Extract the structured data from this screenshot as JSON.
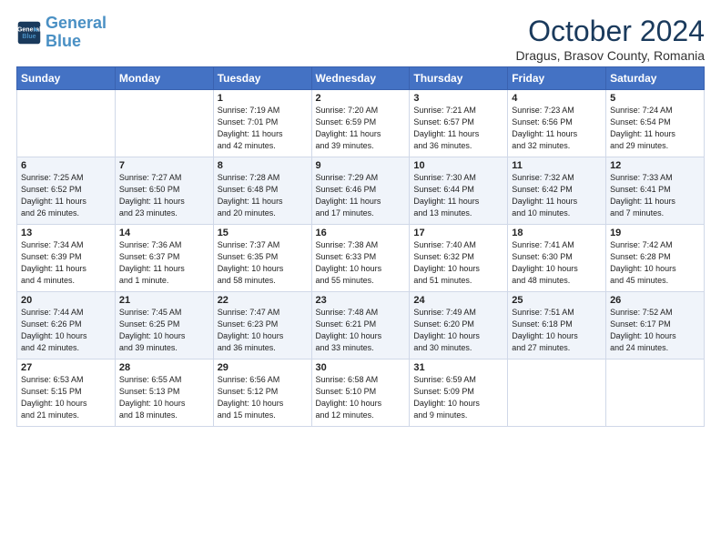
{
  "logo": {
    "line1": "General",
    "line2": "Blue"
  },
  "title": "October 2024",
  "subtitle": "Dragus, Brasov County, Romania",
  "weekdays": [
    "Sunday",
    "Monday",
    "Tuesday",
    "Wednesday",
    "Thursday",
    "Friday",
    "Saturday"
  ],
  "weeks": [
    [
      {
        "day": "",
        "info": ""
      },
      {
        "day": "",
        "info": ""
      },
      {
        "day": "1",
        "info": "Sunrise: 7:19 AM\nSunset: 7:01 PM\nDaylight: 11 hours\nand 42 minutes."
      },
      {
        "day": "2",
        "info": "Sunrise: 7:20 AM\nSunset: 6:59 PM\nDaylight: 11 hours\nand 39 minutes."
      },
      {
        "day": "3",
        "info": "Sunrise: 7:21 AM\nSunset: 6:57 PM\nDaylight: 11 hours\nand 36 minutes."
      },
      {
        "day": "4",
        "info": "Sunrise: 7:23 AM\nSunset: 6:56 PM\nDaylight: 11 hours\nand 32 minutes."
      },
      {
        "day": "5",
        "info": "Sunrise: 7:24 AM\nSunset: 6:54 PM\nDaylight: 11 hours\nand 29 minutes."
      }
    ],
    [
      {
        "day": "6",
        "info": "Sunrise: 7:25 AM\nSunset: 6:52 PM\nDaylight: 11 hours\nand 26 minutes."
      },
      {
        "day": "7",
        "info": "Sunrise: 7:27 AM\nSunset: 6:50 PM\nDaylight: 11 hours\nand 23 minutes."
      },
      {
        "day": "8",
        "info": "Sunrise: 7:28 AM\nSunset: 6:48 PM\nDaylight: 11 hours\nand 20 minutes."
      },
      {
        "day": "9",
        "info": "Sunrise: 7:29 AM\nSunset: 6:46 PM\nDaylight: 11 hours\nand 17 minutes."
      },
      {
        "day": "10",
        "info": "Sunrise: 7:30 AM\nSunset: 6:44 PM\nDaylight: 11 hours\nand 13 minutes."
      },
      {
        "day": "11",
        "info": "Sunrise: 7:32 AM\nSunset: 6:42 PM\nDaylight: 11 hours\nand 10 minutes."
      },
      {
        "day": "12",
        "info": "Sunrise: 7:33 AM\nSunset: 6:41 PM\nDaylight: 11 hours\nand 7 minutes."
      }
    ],
    [
      {
        "day": "13",
        "info": "Sunrise: 7:34 AM\nSunset: 6:39 PM\nDaylight: 11 hours\nand 4 minutes."
      },
      {
        "day": "14",
        "info": "Sunrise: 7:36 AM\nSunset: 6:37 PM\nDaylight: 11 hours\nand 1 minute."
      },
      {
        "day": "15",
        "info": "Sunrise: 7:37 AM\nSunset: 6:35 PM\nDaylight: 10 hours\nand 58 minutes."
      },
      {
        "day": "16",
        "info": "Sunrise: 7:38 AM\nSunset: 6:33 PM\nDaylight: 10 hours\nand 55 minutes."
      },
      {
        "day": "17",
        "info": "Sunrise: 7:40 AM\nSunset: 6:32 PM\nDaylight: 10 hours\nand 51 minutes."
      },
      {
        "day": "18",
        "info": "Sunrise: 7:41 AM\nSunset: 6:30 PM\nDaylight: 10 hours\nand 48 minutes."
      },
      {
        "day": "19",
        "info": "Sunrise: 7:42 AM\nSunset: 6:28 PM\nDaylight: 10 hours\nand 45 minutes."
      }
    ],
    [
      {
        "day": "20",
        "info": "Sunrise: 7:44 AM\nSunset: 6:26 PM\nDaylight: 10 hours\nand 42 minutes."
      },
      {
        "day": "21",
        "info": "Sunrise: 7:45 AM\nSunset: 6:25 PM\nDaylight: 10 hours\nand 39 minutes."
      },
      {
        "day": "22",
        "info": "Sunrise: 7:47 AM\nSunset: 6:23 PM\nDaylight: 10 hours\nand 36 minutes."
      },
      {
        "day": "23",
        "info": "Sunrise: 7:48 AM\nSunset: 6:21 PM\nDaylight: 10 hours\nand 33 minutes."
      },
      {
        "day": "24",
        "info": "Sunrise: 7:49 AM\nSunset: 6:20 PM\nDaylight: 10 hours\nand 30 minutes."
      },
      {
        "day": "25",
        "info": "Sunrise: 7:51 AM\nSunset: 6:18 PM\nDaylight: 10 hours\nand 27 minutes."
      },
      {
        "day": "26",
        "info": "Sunrise: 7:52 AM\nSunset: 6:17 PM\nDaylight: 10 hours\nand 24 minutes."
      }
    ],
    [
      {
        "day": "27",
        "info": "Sunrise: 6:53 AM\nSunset: 5:15 PM\nDaylight: 10 hours\nand 21 minutes."
      },
      {
        "day": "28",
        "info": "Sunrise: 6:55 AM\nSunset: 5:13 PM\nDaylight: 10 hours\nand 18 minutes."
      },
      {
        "day": "29",
        "info": "Sunrise: 6:56 AM\nSunset: 5:12 PM\nDaylight: 10 hours\nand 15 minutes."
      },
      {
        "day": "30",
        "info": "Sunrise: 6:58 AM\nSunset: 5:10 PM\nDaylight: 10 hours\nand 12 minutes."
      },
      {
        "day": "31",
        "info": "Sunrise: 6:59 AM\nSunset: 5:09 PM\nDaylight: 10 hours\nand 9 minutes."
      },
      {
        "day": "",
        "info": ""
      },
      {
        "day": "",
        "info": ""
      }
    ]
  ]
}
